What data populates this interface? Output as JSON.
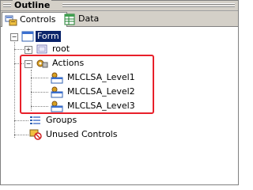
{
  "panel": {
    "title": "Outline"
  },
  "tabs": [
    {
      "label": "Controls",
      "icon": "controls-icon",
      "active": true
    },
    {
      "label": "Data",
      "icon": "data-grid-icon",
      "active": false
    }
  ],
  "tree": {
    "root": {
      "label": "Form",
      "icon": "form-icon",
      "expanded": true,
      "selected": true
    },
    "root_child": {
      "label": "root",
      "icon": "container-icon",
      "expanded": false
    },
    "actions": {
      "label": "Actions",
      "icon": "actions-icon",
      "expanded": true,
      "items": [
        {
          "label": "MLCLSA_Level1",
          "icon": "action-item-icon"
        },
        {
          "label": "MLCLSA_Level2",
          "icon": "action-item-icon"
        },
        {
          "label": "MLCLSA_Level3",
          "icon": "action-item-icon"
        }
      ]
    },
    "groups": {
      "label": "Groups",
      "icon": "groups-icon"
    },
    "unused": {
      "label": "Unused Controls",
      "icon": "unused-controls-icon"
    }
  },
  "highlight": {
    "color": "#e8202a"
  }
}
